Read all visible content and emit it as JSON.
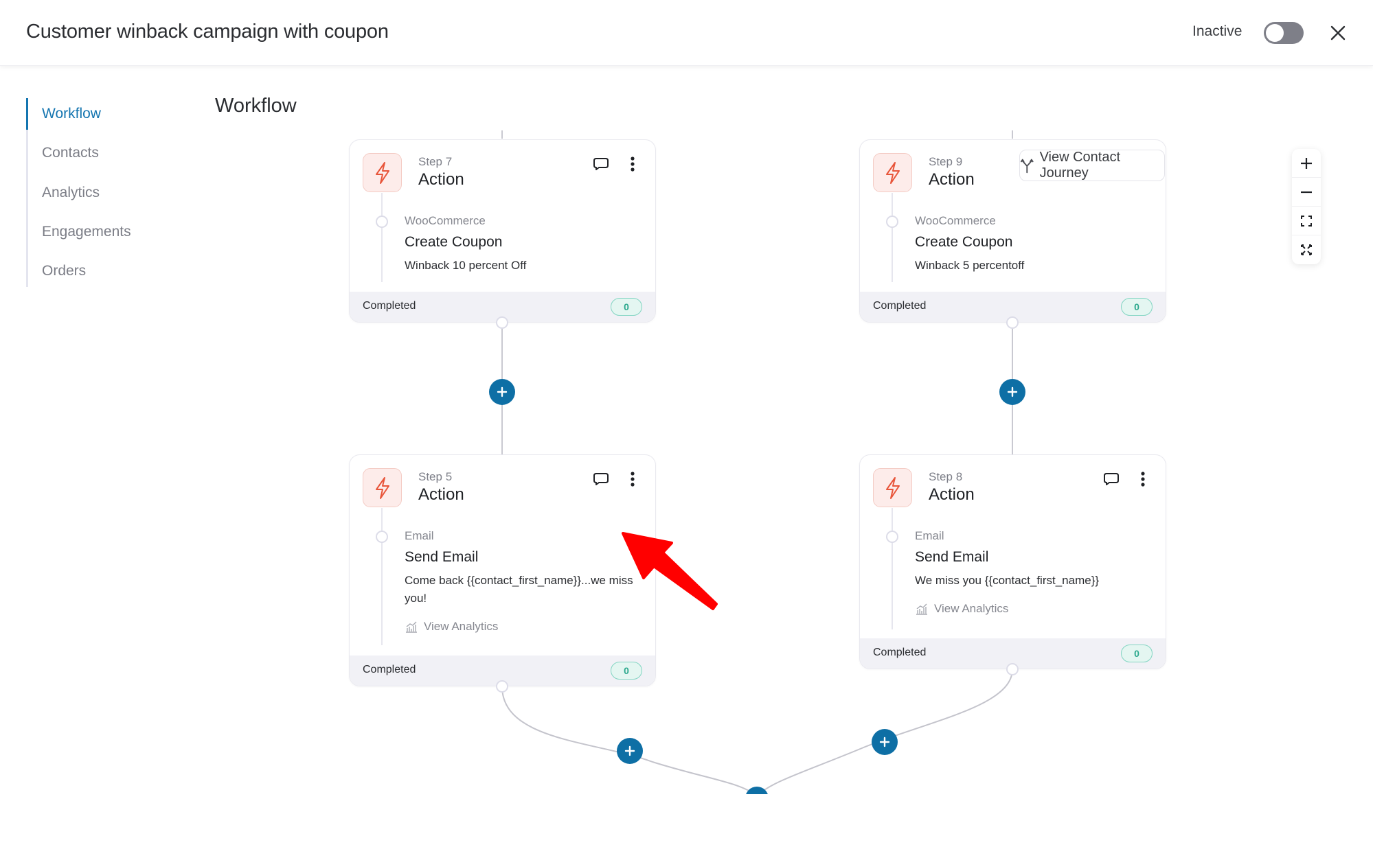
{
  "header": {
    "title": "Customer winback campaign with coupon",
    "status_label": "Inactive",
    "toggle_on": false,
    "close_icon": "close-icon"
  },
  "sidebar": {
    "items": [
      {
        "label": "Workflow",
        "active": true
      },
      {
        "label": "Contacts",
        "active": false
      },
      {
        "label": "Analytics",
        "active": false
      },
      {
        "label": "Engagements",
        "active": false
      },
      {
        "label": "Orders",
        "active": false
      }
    ]
  },
  "main": {
    "title": "Workflow",
    "view_contact_journey": "View Contact Journey",
    "zoom_controls": [
      "zoom-in-icon",
      "zoom-out-icon",
      "fit-view-icon",
      "fullscreen-icon"
    ]
  },
  "cards": [
    {
      "step": "Step 7",
      "type": "Action",
      "app": "WooCommerce",
      "action": "Create Coupon",
      "description": "Winback 10 percent Off",
      "analytics": null,
      "status": "Completed",
      "count": "0"
    },
    {
      "step": "Step 9",
      "type": "Action",
      "app": "WooCommerce",
      "action": "Create Coupon",
      "description": "Winback 5 percentoff",
      "analytics": null,
      "status": "Completed",
      "count": "0"
    },
    {
      "step": "Step 5",
      "type": "Action",
      "app": "Email",
      "action": "Send Email",
      "description": "Come back {{contact_first_name}}...we miss you!",
      "analytics": "View Analytics",
      "status": "Completed",
      "count": "0"
    },
    {
      "step": "Step 8",
      "type": "Action",
      "app": "Email",
      "action": "Send Email",
      "description": "We miss you {{contact_first_name}}",
      "analytics": "View Analytics",
      "status": "Completed",
      "count": "0"
    }
  ],
  "colors": {
    "accent": "#1475b0",
    "add_button": "#0e6fa5",
    "action_icon": "#e8553a",
    "badge_text": "#2ba88d",
    "annotation_arrow": "#ff0000"
  }
}
